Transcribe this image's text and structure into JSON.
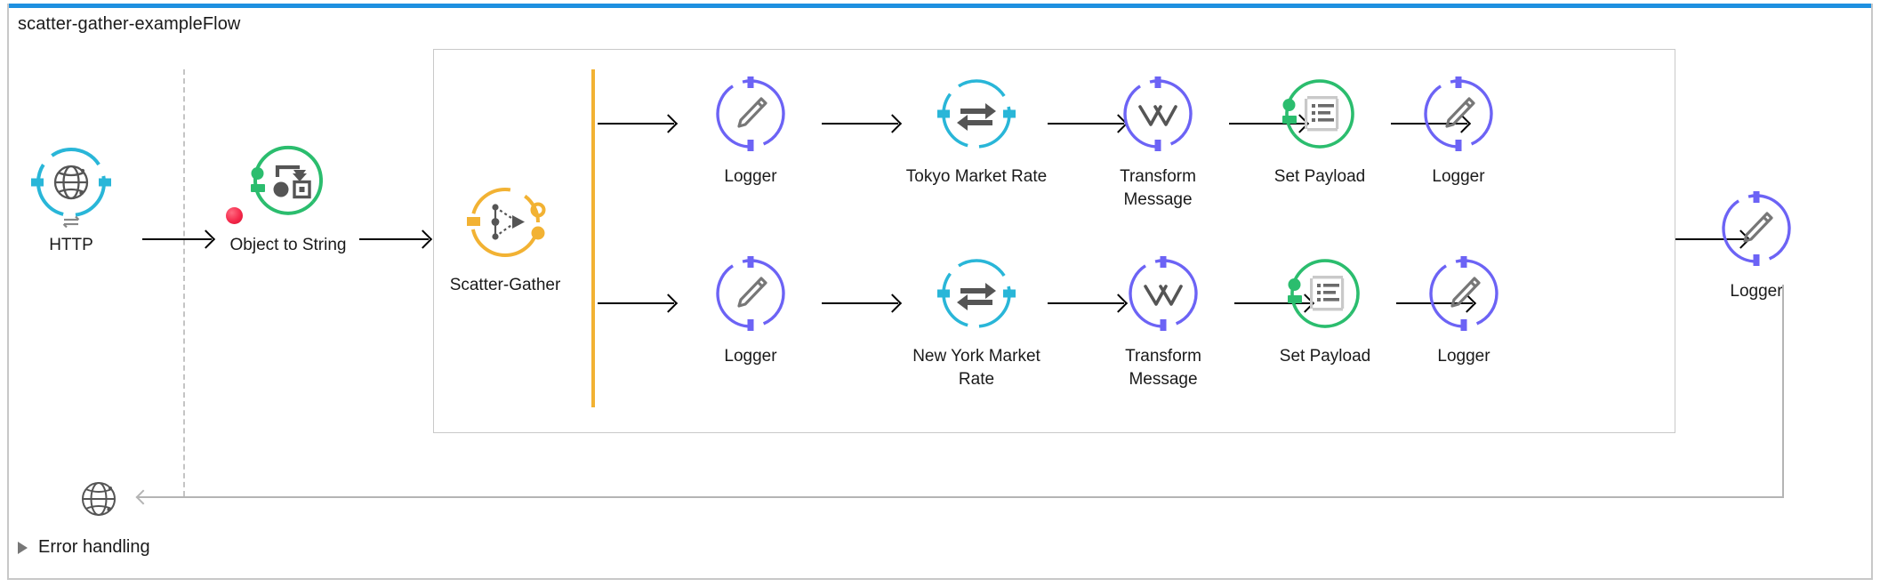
{
  "window": {
    "accent_color": "#1e90e0",
    "border_color": "#c8c8c8"
  },
  "flow": {
    "title": "scatter-gather-exampleFlow"
  },
  "colors": {
    "http_cyan": "#29b6d8",
    "green": "#2bbd6e",
    "amber": "#f2b233",
    "purple": "#6c63f5",
    "gray_icon": "#555555",
    "connector": "#000000",
    "return_line": "#b4b4b4",
    "breakpoint_red": "#f5294b"
  },
  "source": {
    "node": {
      "label": "HTTP",
      "icon": "globe-icon",
      "color": "#29b6d8"
    }
  },
  "process": {
    "object_to_string": {
      "label": "Object to String",
      "icon": "transform-object-icon",
      "color": "#2bbd6e",
      "has_breakpoint": true
    },
    "scatter_gather": {
      "label": "Scatter-Gather",
      "icon": "scatter-gather-icon",
      "color": "#f2b233"
    },
    "routes": [
      {
        "name": "route-tokyo",
        "steps": [
          {
            "label": "Logger",
            "icon": "pencil-icon",
            "color": "#6c63f5",
            "kind": "logger"
          },
          {
            "label": "Tokyo Market Rate",
            "icon": "exchange-arrows-icon",
            "color": "#29b6d8",
            "kind": "connector"
          },
          {
            "label": "Transform\nMessage",
            "icon": "dataweave-icon",
            "color": "#6c63f5",
            "kind": "transform"
          },
          {
            "label": "Set Payload",
            "icon": "document-lines-icon",
            "color": "#2bbd6e",
            "kind": "setpayload"
          },
          {
            "label": "Logger",
            "icon": "pencil-icon",
            "color": "#6c63f5",
            "kind": "logger"
          }
        ]
      },
      {
        "name": "route-newyork",
        "steps": [
          {
            "label": "Logger",
            "icon": "pencil-icon",
            "color": "#6c63f5",
            "kind": "logger"
          },
          {
            "label": "New York Market\nRate",
            "icon": "exchange-arrows-icon",
            "color": "#29b6d8",
            "kind": "connector"
          },
          {
            "label": "Transform\nMessage",
            "icon": "dataweave-icon",
            "color": "#6c63f5",
            "kind": "transform"
          },
          {
            "label": "Set Payload",
            "icon": "document-lines-icon",
            "color": "#2bbd6e",
            "kind": "setpayload"
          },
          {
            "label": "Logger",
            "icon": "pencil-icon",
            "color": "#6c63f5",
            "kind": "logger"
          }
        ]
      }
    ],
    "final_logger": {
      "label": "Logger",
      "icon": "pencil-icon",
      "color": "#6c63f5"
    }
  },
  "response": {
    "icon": "globe-icon",
    "label": ""
  },
  "error_handling": {
    "label": "Error handling",
    "expanded": false,
    "twisty_icon": "triangle-right-icon"
  }
}
